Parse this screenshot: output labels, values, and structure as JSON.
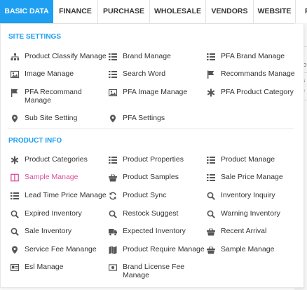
{
  "nav": {
    "tabs": [
      {
        "label": "BASIC DATA",
        "active": true
      },
      {
        "label": "FINANCE"
      },
      {
        "label": "PURCHASE"
      },
      {
        "label": "WHOLESALE"
      },
      {
        "label": "VENDORS"
      },
      {
        "label": "WEBSITE"
      },
      {
        "label": "F"
      }
    ]
  },
  "background_fragments": [
    "fo",
    "a",
    "e"
  ],
  "colors": {
    "accent": "#1e9ff2",
    "active_item": "#d84f9c",
    "icon": "#555555"
  },
  "sections": [
    {
      "title": "SITE SETTINGS",
      "items": [
        {
          "label": "Product Classify Manage",
          "icon": "sitemap-icon"
        },
        {
          "label": "Brand Manage",
          "icon": "list-icon"
        },
        {
          "label": "PFA Brand Manage",
          "icon": "list-icon"
        },
        {
          "label": "Image Manage",
          "icon": "image-icon"
        },
        {
          "label": "Search Word",
          "icon": "list-icon"
        },
        {
          "label": "Recommands Manage",
          "icon": "flag-icon"
        },
        {
          "label": "PFA Recommand Manage",
          "icon": "flag-icon"
        },
        {
          "label": "PFA Image Manage",
          "icon": "image-icon"
        },
        {
          "label": "PFA Product Category",
          "icon": "asterisk-icon"
        },
        {
          "label": "Sub Site Setting",
          "icon": "map-pin-icon"
        },
        {
          "label": "PFA Settings",
          "icon": "map-pin-icon"
        }
      ]
    },
    {
      "title": "PRODUCT INFO",
      "items": [
        {
          "label": "Product Categories",
          "icon": "asterisk-icon"
        },
        {
          "label": "Product Properties",
          "icon": "list-icon"
        },
        {
          "label": "Product Manage",
          "icon": "list-icon"
        },
        {
          "label": "Sample Manage",
          "icon": "columns-icon",
          "active": true
        },
        {
          "label": "Product Samples",
          "icon": "basket-icon"
        },
        {
          "label": "Sale Price Manage",
          "icon": "list-icon"
        },
        {
          "label": "Lead Time Price Manage",
          "icon": "list-icon"
        },
        {
          "label": "Product Sync",
          "icon": "sync-icon"
        },
        {
          "label": "Inventory Inquiry",
          "icon": "search-icon"
        },
        {
          "label": "Expired Inventory",
          "icon": "search-icon"
        },
        {
          "label": "Restock Suggest",
          "icon": "search-icon"
        },
        {
          "label": "Warning Inventory",
          "icon": "search-icon"
        },
        {
          "label": "Sale Inventory",
          "icon": "search-icon"
        },
        {
          "label": "Expected Inventory",
          "icon": "truck-icon"
        },
        {
          "label": "Recent Arrival",
          "icon": "basket-icon"
        },
        {
          "label": "Service Fee Manange",
          "icon": "map-pin-icon"
        },
        {
          "label": "Product Require Manage",
          "icon": "map-icon"
        },
        {
          "label": "Sample Manage",
          "icon": "basket-icon"
        },
        {
          "label": "Esl Manage",
          "icon": "id-card-icon"
        },
        {
          "label": "Brand License Fee Manage",
          "icon": "money-icon"
        }
      ]
    }
  ]
}
